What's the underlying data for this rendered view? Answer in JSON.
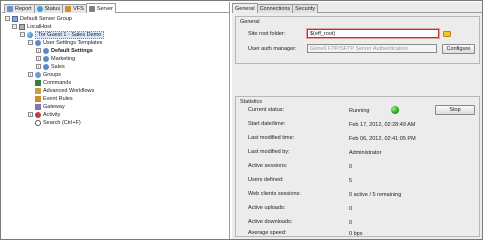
{
  "left_tabs": [
    {
      "label": "Report",
      "icon": "report-icon",
      "color": "#6a8fd0"
    },
    {
      "label": "Status",
      "icon": "status-icon",
      "color": "#3aa0d8"
    },
    {
      "label": "VFS",
      "icon": "vfs-icon",
      "color": "#d09030"
    },
    {
      "label": "Server",
      "icon": "server-icon",
      "color": "#808080"
    }
  ],
  "tree": {
    "root": "Default Server Group",
    "localhost": "LocalHost",
    "guest": "Tor Guest 1 - Sales Demo",
    "user_settings_templates": "User Settings Templates",
    "default_settings": "Default Settings",
    "marketing": "Marketing",
    "sales": "Sales",
    "groups": "Groups",
    "commands": "Commands",
    "advanced_workflows": "Advanced Workflows",
    "event_rules": "Event Rules",
    "gateway": "Gateway",
    "activity": "Activity",
    "search": "Search (Ctrl+F)"
  },
  "right_tabs": [
    "General",
    "Connections",
    "Security"
  ],
  "general": {
    "title": "General",
    "site_root_label": "Site root folder:",
    "site_root_value": "$(eff_root)",
    "user_auth_label": "User auth manager:",
    "user_auth_value": "Gene6 FTP/SFTP Server Authentication",
    "configure_label": "Configure"
  },
  "statistics": {
    "title": "Statistics",
    "stop_label": "Stop",
    "rows": [
      {
        "label": "Current status:",
        "value": "Running"
      },
      {
        "label": "Start date/time:",
        "value": "Feb 17, 2012, 02:28:49 AM"
      },
      {
        "label": "Last modified time:",
        "value": "Feb 06, 2012, 02:41:05 PM"
      },
      {
        "label": "Last modified by:",
        "value": "Administrator"
      },
      {
        "label": "Active sessions:",
        "value": "0"
      },
      {
        "label": "Users defined:",
        "value": "5"
      },
      {
        "label": "Web clients sessions:",
        "value": "0 active / 5 remaining"
      },
      {
        "label": "Active uploads:",
        "value": "0"
      },
      {
        "label": "Active downloads:",
        "value": "0"
      },
      {
        "label": "Average speed:",
        "value": "0 bps"
      }
    ]
  },
  "colors": {
    "status_running": "#1ea81e",
    "folder": "#f2c230",
    "focus_border": "#c0302a"
  }
}
